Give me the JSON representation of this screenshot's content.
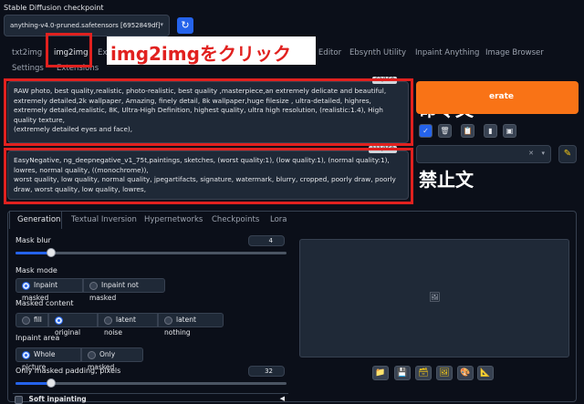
{
  "checkpoint": {
    "label": "Stable Diffusion checkpoint",
    "value": "anything-v4.0-pruned.safetensors [6952849df]"
  },
  "tabs_row1": [
    "txt2img",
    "img2img",
    "Ex",
    "e Editor",
    "Ebsynth Utility",
    "Inpaint Anything",
    "Image Browser"
  ],
  "tabs_row2": [
    "Settings",
    "Extensions"
  ],
  "annotations": {
    "click": "img2imgをクリック",
    "positive": "命令文",
    "negative": "禁止文"
  },
  "prompt": {
    "counter": "62/150",
    "text": "RAW photo, best quality,realistic, photo-realistic, best quality ,masterpiece,an extremely delicate and beautiful, extremely detailed,2k wallpaper, Amazing, finely detail, 8k wallpaper,huge filesize , ultra-detailed, highres, extremely detailed,realistic, 8K, Ultra-High Definition, highest quality, ultra high resolution, (realistic:1.4), High quality texture,\n(extremely detailed eyes and face),"
  },
  "negative_prompt": {
    "counter": "111/150",
    "text": "EasyNegative, ng_deepnegative_v1_75t,paintings, sketches, (worst quality:1), (low quality:1), (normal quality:1), lowres, normal quality, ((monochrome)),\nworst quality, low quality, normal quality, jpegartifacts, signature, watermark, blurry, cropped, poorly draw, poorly draw, worst quality, low quality, lowres,"
  },
  "generate_label": "erate",
  "subtabs": [
    "Generation",
    "Textual Inversion",
    "Hypernetworks",
    "Checkpoints",
    "Lora"
  ],
  "mask_blur": {
    "label": "Mask blur",
    "value": "4",
    "fraction": 0.13
  },
  "mask_mode": {
    "label": "Mask mode",
    "options": [
      "Inpaint masked",
      "Inpaint not masked"
    ],
    "selected": 0
  },
  "masked_content": {
    "label": "Masked content",
    "options": [
      "fill",
      "original",
      "latent noise",
      "latent nothing"
    ],
    "selected": 1
  },
  "inpaint_area": {
    "label": "Inpaint area",
    "options": [
      "Whole picture",
      "Only masked"
    ],
    "selected": 0
  },
  "padding": {
    "label": "Only masked padding, pixels",
    "value": "32",
    "fraction": 0.13
  },
  "soft_inpainting": "Soft inpainting",
  "colors": {
    "accent": "#2563eb",
    "generate": "#f97316",
    "annotation_red": "#e1211f"
  }
}
